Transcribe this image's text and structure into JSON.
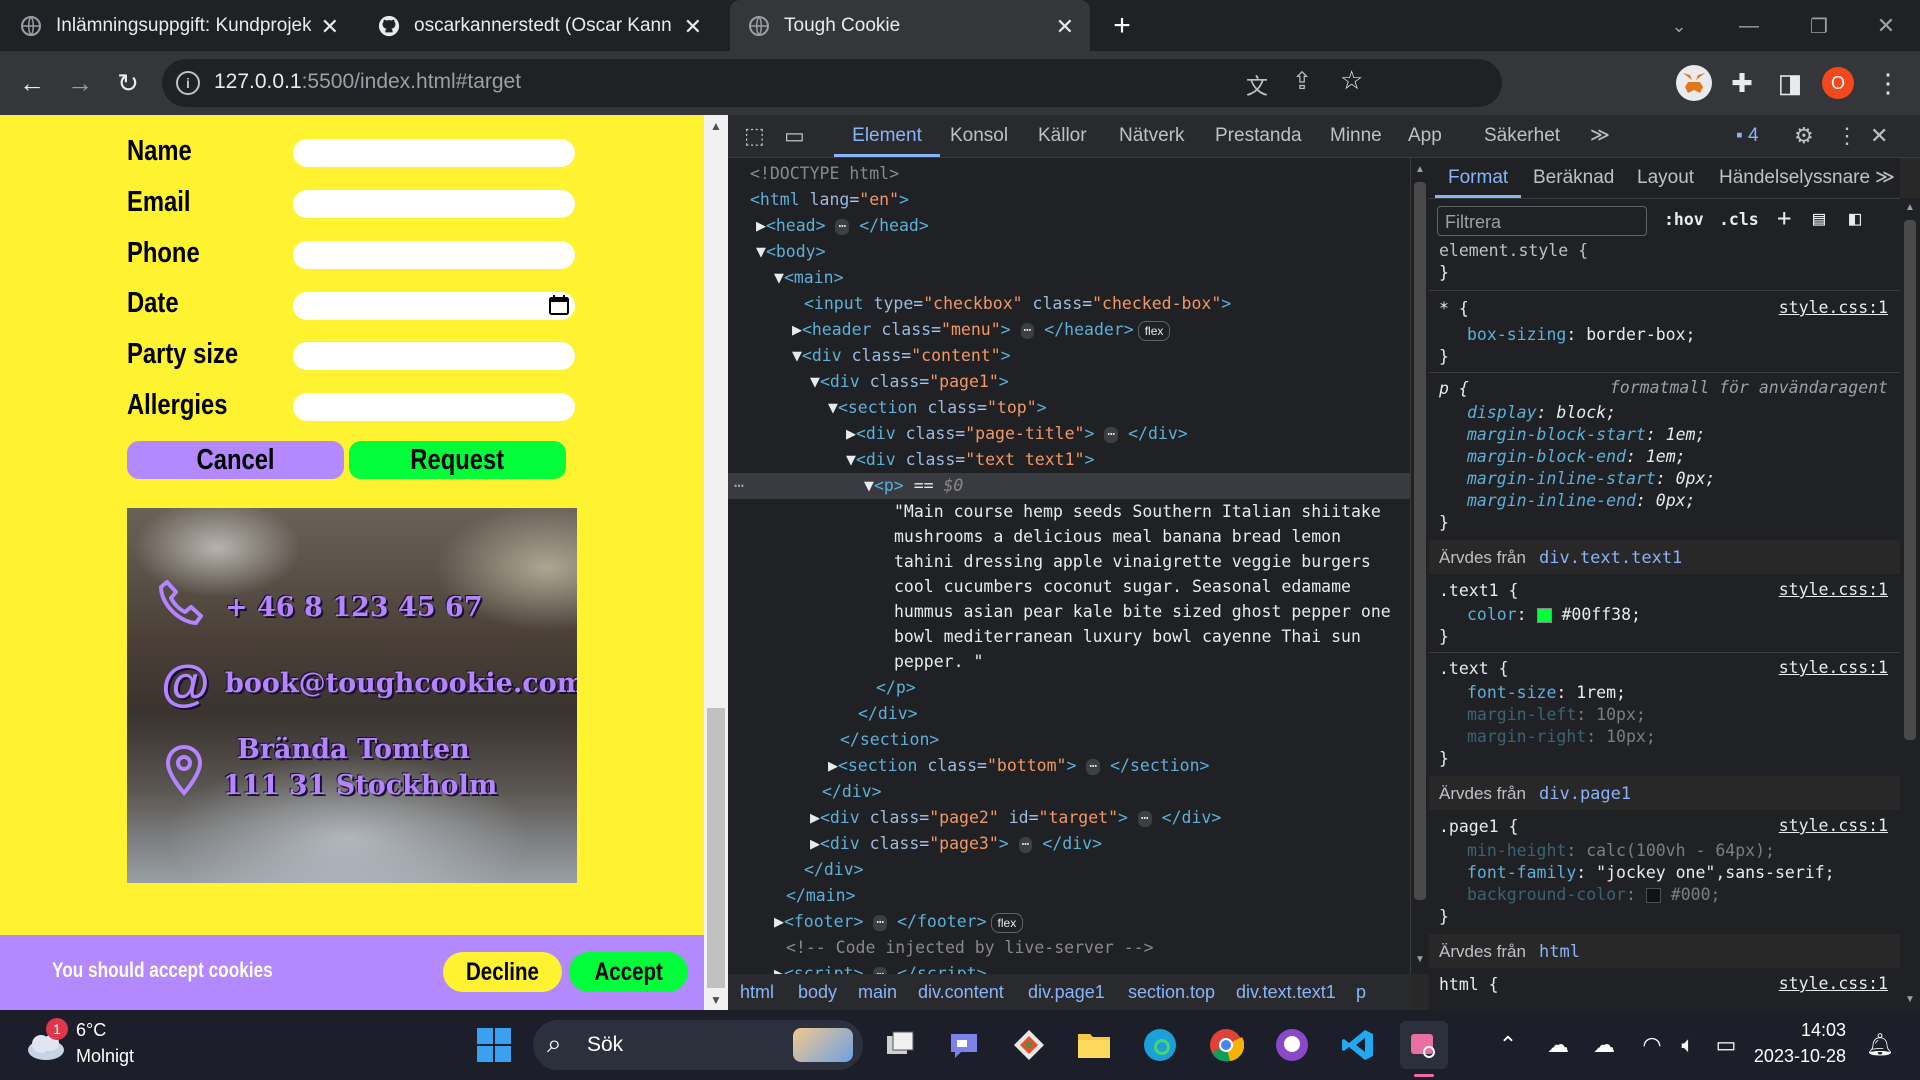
{
  "browser": {
    "tabs": [
      {
        "title": "Inlämningsuppgift: Kundprojekt",
        "active": false
      },
      {
        "title": "oscarkannerstedt (Oscar Kanners",
        "active": false
      },
      {
        "title": "Tough Cookie",
        "active": true
      }
    ],
    "url_host": "127.0.0.1",
    "url_rest": ":5500/index.html#target",
    "profile_letter": "O"
  },
  "form": {
    "labels": [
      "Name",
      "Email",
      "Phone",
      "Date",
      "Party size",
      "Allergies"
    ],
    "cancel": "Cancel",
    "request": "Request"
  },
  "contact": {
    "phone": "+ 46 8 123 45 67",
    "email": "book@toughcookie.com",
    "address1": "Brända Tomten",
    "address2": "111 31 Stockholm"
  },
  "cookie": {
    "text": "You should accept cookies",
    "decline": "Decline",
    "accept": "Accept"
  },
  "devtools": {
    "tabs": [
      "Element",
      "Konsol",
      "Källor",
      "Nätverk",
      "Prestanda",
      "Minne",
      "App",
      "Säkerhet"
    ],
    "issues_count": "4",
    "styles_tabs": [
      "Format",
      "Beräknad",
      "Layout",
      "Händelselyssnare"
    ],
    "filter_placeholder": "Filtrera",
    "hov": ":hov",
    "cls": ".cls",
    "paragraph": [
      "\"Main course hemp seeds Southern Italian shiitake",
      "mushrooms a delicious meal banana bread lemon",
      "tahini dressing apple vinaigrette veggie burgers",
      "cool cucumbers coconut sugar. Seasonal edamame",
      "hummus asian pear kale bite sized ghost pepper one",
      "bowl mediterranean luxury bowl cayenne Thai sun",
      "pepper. \""
    ],
    "crumbs": [
      "html",
      "body",
      "main",
      "div.content",
      "div.page1",
      "section.top",
      "div.text.text1",
      "p"
    ],
    "styles": {
      "element_style": "element.style {",
      "src": "style.css:1",
      "ua_note": "formatmall för användaragent",
      "inherited_text1": "Ärvdes från",
      "inherited_text1_sel": "div.text.text1",
      "inherited_page1_sel": "div.page1",
      "inherited_html_sel": "html",
      "text1_color": "#00ff38"
    }
  },
  "taskbar": {
    "temp": "6°C",
    "weather": "Molnigt",
    "search": "Sök",
    "time": "14:03",
    "date": "2023-10-28",
    "weather_badge": "1"
  }
}
